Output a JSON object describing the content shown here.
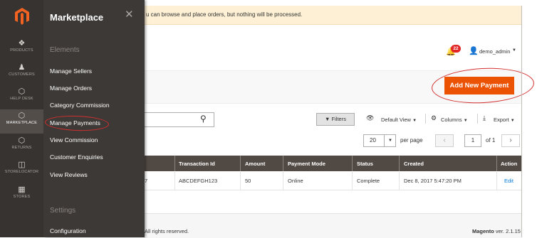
{
  "nav": {
    "items": [
      {
        "label": "PRODUCTS",
        "icon": "cube-icon"
      },
      {
        "label": "CUSTOMERS",
        "icon": "person-icon"
      },
      {
        "label": "HELP DESK",
        "icon": "hexagon-icon"
      },
      {
        "label": "MARKETPLACE",
        "icon": "hexagon-icon"
      },
      {
        "label": "RETURNS",
        "icon": "hexagon-icon"
      },
      {
        "label": "STORELOCATOR",
        "icon": "book-icon"
      },
      {
        "label": "STORES",
        "icon": "store-icon"
      }
    ]
  },
  "flyout": {
    "title": "Marketplace",
    "section_elements": "Elements",
    "links": [
      "Manage Sellers",
      "Manage Orders",
      "Category Commission",
      "Manage Payments",
      "View Commission",
      "Customer Enquiries",
      "View Reviews"
    ],
    "section_settings": "Settings",
    "config_link": "Configuration"
  },
  "banner": {
    "text": "u can browse and place orders, but nothing will be processed."
  },
  "header": {
    "notification_count": "22",
    "user_name": "demo_admin"
  },
  "actions": {
    "add_new_payment": "Add New Payment"
  },
  "toolbar": {
    "filters": "Filters",
    "default_view": "Default View",
    "columns": "Columns",
    "export": "Export"
  },
  "pagination": {
    "per_page_value": "20",
    "per_page_label": "per page",
    "current_page": "1",
    "of_label": "of 1"
  },
  "table": {
    "headers": [
      "Transaction Id",
      "Amount",
      "Payment Mode",
      "Status",
      "Created",
      "Action"
    ],
    "rows": [
      {
        "first_fragment": "7",
        "transaction_id": "ABCDEFGH123",
        "amount": "50",
        "payment_mode": "Online",
        "status": "Complete",
        "created": "Dec 8, 2017 5:47:20 PM",
        "action": "Edit"
      }
    ]
  },
  "footer": {
    "copyright": "All rights reserved.",
    "brand": "Magento",
    "version": " ver. 2.1.15"
  },
  "colors": {
    "sidebar": "#373330",
    "flyout": "#3d3936",
    "accent": "#eb5202",
    "table_header": "#514943",
    "annotation": "#d32f2f"
  }
}
